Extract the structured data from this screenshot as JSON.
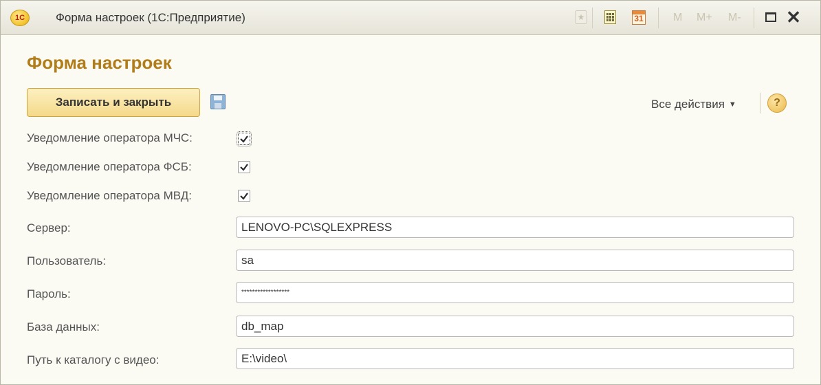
{
  "window": {
    "app_logo_text": "1С",
    "title": "Форма настроек  (1С:Предприятие)",
    "toolbar": {
      "favorite_icon": "star-icon",
      "calculator_icon": "calculator-icon",
      "calendar_icon": "calendar-icon",
      "calendar_day": "31",
      "memory_labels": [
        "M",
        "M+",
        "M-"
      ],
      "maximize_icon": "maximize-icon",
      "close_glyph": "✕"
    }
  },
  "form": {
    "title": "Форма настроек",
    "commands": {
      "save_close_label": "Записать и закрыть",
      "save_icon": "floppy-disk-icon",
      "all_actions_label": "Все действия",
      "help_label": "?"
    },
    "checkboxes": [
      {
        "label": "Уведомление оператора МЧС:",
        "checked": true
      },
      {
        "label": "Уведомление оператора ФСБ:",
        "checked": true
      },
      {
        "label": "Уведомление оператора МВД:",
        "checked": true
      }
    ],
    "fields": [
      {
        "label": "Сервер:",
        "value": "LENOVO-PC\\SQLEXPRESS"
      },
      {
        "label": "Пользователь:",
        "value": "sa"
      },
      {
        "label": "Пароль:",
        "value": "******************"
      },
      {
        "label": "База данных:",
        "value": "db_map"
      },
      {
        "label": "Путь к каталогу с видео:",
        "value": "E:\\video\\"
      }
    ]
  },
  "colors": {
    "title_accent": "#b07d1a",
    "primary_button_bg": "#f4d98a",
    "window_bg": "#fbfaf3"
  }
}
